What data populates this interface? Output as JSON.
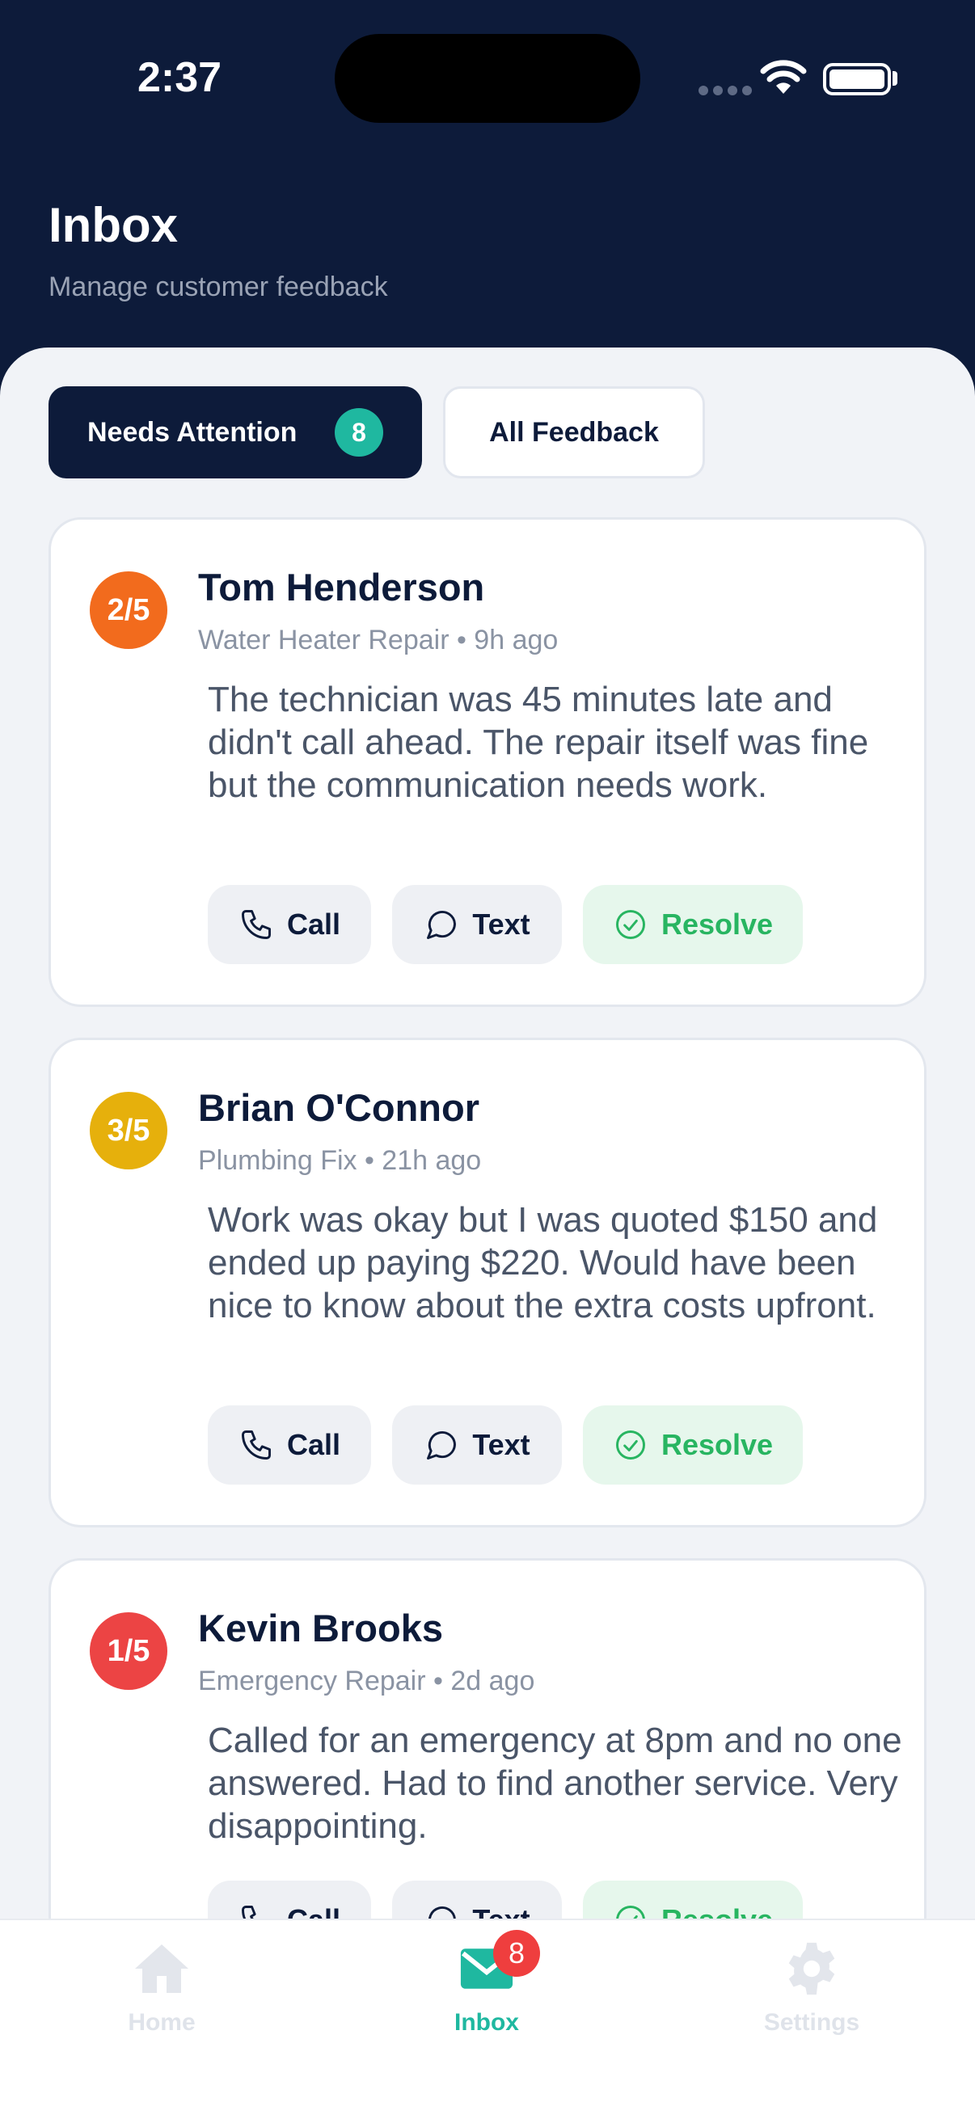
{
  "status_bar": {
    "time": "2:37"
  },
  "header": {
    "title": "Inbox",
    "subtitle": "Manage customer feedback"
  },
  "tabs": [
    {
      "label": "Needs Attention",
      "count": "8",
      "active": true
    },
    {
      "label": "All Feedback",
      "active": false
    }
  ],
  "feedback": [
    {
      "rating": "2/5",
      "rating_color": "#f26b1d",
      "name": "Tom Henderson",
      "meta": "Water Heater Repair • 9h ago",
      "message": "The technician was 45 minutes late and didn't call ahead. The repair itself was fine but the communication needs work."
    },
    {
      "rating": "3/5",
      "rating_color": "#e6b00c",
      "name": "Brian O'Connor",
      "meta": "Plumbing Fix • 21h ago",
      "message": "Work was okay but I was quoted $150 and ended up paying $220. Would have been nice to know about the extra costs upfront."
    },
    {
      "rating": "1/5",
      "rating_color": "#ec4444",
      "name": "Kevin Brooks",
      "meta": "Emergency Repair • 2d ago",
      "message": "Called for an emergency at 8pm and no one answered. Had to find another service. Very disappointing."
    }
  ],
  "actions": {
    "call": "Call",
    "text": "Text",
    "resolve": "Resolve"
  },
  "bottom_nav": [
    {
      "label": "Home",
      "icon": "home-icon"
    },
    {
      "label": "Inbox",
      "icon": "mail-icon",
      "badge": "8",
      "active": true
    },
    {
      "label": "Settings",
      "icon": "gear-icon"
    }
  ],
  "colors": {
    "navy": "#0d1b3a",
    "teal": "#1fb8a0",
    "resolve_green": "#28b561",
    "badge_red": "#ef3e3e"
  }
}
